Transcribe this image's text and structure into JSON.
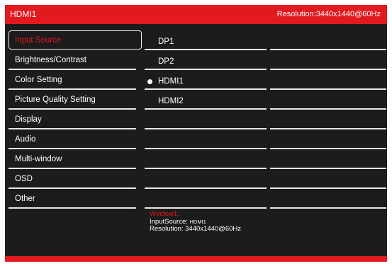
{
  "header": {
    "title": "HDMI1",
    "resolution": "Resolution:3440x1440@60Hz"
  },
  "menu": [
    "Input Source",
    "Brightness/Contrast",
    "Color Setting",
    "Picture Quality Setting",
    "Display",
    "Audio",
    "Multi-window",
    "OSD",
    "Other"
  ],
  "selected_menu": "Input Source",
  "options": [
    "DP1",
    "DP2",
    "HDMI1",
    "HDMI2",
    "",
    "",
    "",
    "",
    ""
  ],
  "active_option": "HDMI1",
  "info": {
    "window_label": "Window1:",
    "input_label": "InputSource:",
    "input_value": "HDMI1",
    "res_label": "Resolution:",
    "res_value": "3440x1440@60Hz"
  },
  "colors": {
    "accent": "#e2191e",
    "background": "#1c1c1c",
    "text": "#ffffff"
  }
}
